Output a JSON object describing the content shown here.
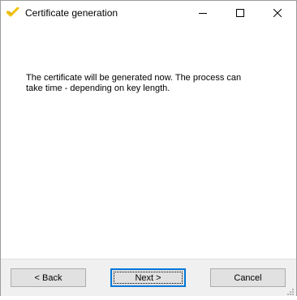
{
  "window": {
    "title": "Certificate generation",
    "app_icon": "checkmark-logo-icon",
    "controls": [
      "minimize-icon",
      "maximize-icon",
      "close-icon"
    ]
  },
  "content": {
    "message": "The certificate will be generated now. The process can\ntake time - depending on key length."
  },
  "buttons": {
    "back": "< Back",
    "next": "Next >",
    "cancel": "Cancel"
  },
  "colors": {
    "focus_border": "#0078d7",
    "footer_background": "#f0f0f0",
    "app_icon": "#f2c200"
  }
}
